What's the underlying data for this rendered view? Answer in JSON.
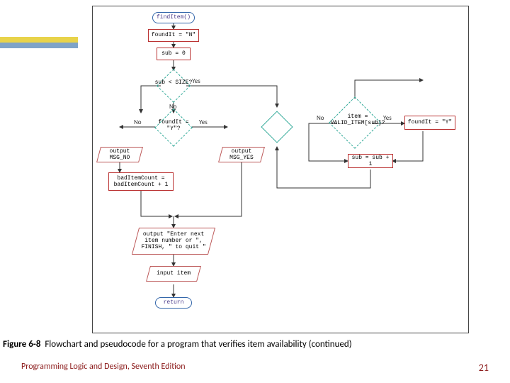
{
  "figure_label": "Figure 6-8",
  "caption": "Flowchart and pseudocode for a program that verifies item availability (continued)",
  "footer_left": "Programming Logic and Design, Seventh Edition",
  "footer_page": "21",
  "nodes": {
    "start": "findItem()",
    "init_found": "foundIt = \"N\"",
    "init_sub": "sub = 0",
    "dec_size": "sub < SIZE?",
    "dec_found": "foundIt = \"Y\"?",
    "out_no": "output MSG_NO",
    "out_yes": "output MSG_YES",
    "inc_bad": "badItemCount = badItemCount + 1",
    "out_prompt": "output \"Enter next item number or \", FINISH, \" to quit \"",
    "in_item": "input item",
    "ret": "return",
    "dec_match": "item = VALID_ITEM[sub]?",
    "set_found": "foundIt = \"Y\"",
    "inc_sub": "sub = sub + 1"
  },
  "edge_labels": {
    "yes": "Yes",
    "no": "No"
  }
}
